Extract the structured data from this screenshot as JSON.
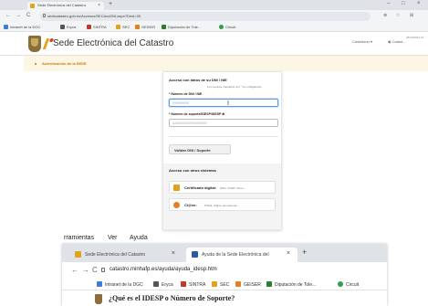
{
  "browser": {
    "tab_title": "Sede Electrónica del Catastro",
    "tab_close": "×",
    "new_tab": "+",
    "window_controls": [
      "–",
      "□",
      "×"
    ],
    "nav": {
      "back": "←",
      "forward": "→",
      "reload": "C"
    },
    "url": "sedecatastro.gob.es/Accesos/SECAccDNI.aspx?Dest=35",
    "right_icons": [
      "⊕",
      "☆",
      "⊞"
    ],
    "bookmarks": [
      {
        "label": "Intranet de la DGC",
        "color": "#3b7dd8"
      },
      {
        "label": "Eryca",
        "color": "#555555"
      },
      {
        "label": "SINTRA",
        "color": "#c0392b"
      },
      {
        "label": "SEC",
        "color": "#e2a21b"
      },
      {
        "label": "GEISER",
        "color": "#e67e22"
      },
      {
        "label": "Diputación de Tole...",
        "color": "#2e7d32"
      },
      {
        "label": "Circuit",
        "color": "#2e9e4f"
      }
    ]
  },
  "site": {
    "title": "Sede Electrónica del Catastro",
    "lang": "Castellano ▾",
    "user": "◉ Catast...",
    "datetime": "25/10/2022 13:..."
  },
  "leftnav": {
    "link": "Autenticación de la SEDE"
  },
  "form": {
    "title": "Acceso con datos de su DNI / NIE",
    "note": "Los campos marcados con * son obligatorios",
    "dni_label": "* Número de DNI / NIE",
    "dni_placeholder": "99999999R",
    "support_label": "* Número de soporte/IDESP/IDESP ⊕",
    "support_placeholder": "AAA000000/E00000000",
    "validate_button": "Validar DNI / Soporte",
    "others_title": "Acceso con otros sistemas",
    "options": [
      {
        "label": "Certificado digital:",
        "sub": "DNIe, FNMT, Otros...",
        "color": "#e2a21b"
      },
      {
        "label": "Cl@ve:",
        "sub": "PIN24, Cl@ve permanente...",
        "color": "#e67e22"
      }
    ]
  },
  "menubar": [
    "rramientas",
    "Ver",
    "Ayuda"
  ],
  "window2": {
    "tabs": [
      {
        "title": "Sede Electrónica del Catastro",
        "close": "×",
        "color": "#e2a21b",
        "active": false
      },
      {
        "title": "Ayuda de la Sede Electrónica del",
        "close": "×",
        "color": "#2c5aa0",
        "active": true
      }
    ],
    "new_tab": "+",
    "nav": {
      "back": "←",
      "forward": "→",
      "reload": "C"
    },
    "url": "catastro.minhafp.es/ayuda/ayuda_idesp.htm",
    "bookmarks": [
      {
        "label": "Intranet de la DGC",
        "color": "#3b7dd8"
      },
      {
        "label": "Eryca",
        "color": "#555555"
      },
      {
        "label": "SINTRA",
        "color": "#c0392b"
      },
      {
        "label": "SEC",
        "color": "#e2a21b"
      },
      {
        "label": "GEISER",
        "color": "#e67e22"
      },
      {
        "label": "Diputación de Tole...",
        "color": "#2e7d32"
      },
      {
        "label": "Circuit",
        "color": "#2e9e4f"
      }
    ],
    "heading": "¿Qué es el IDESP o Número de Soporte?"
  }
}
